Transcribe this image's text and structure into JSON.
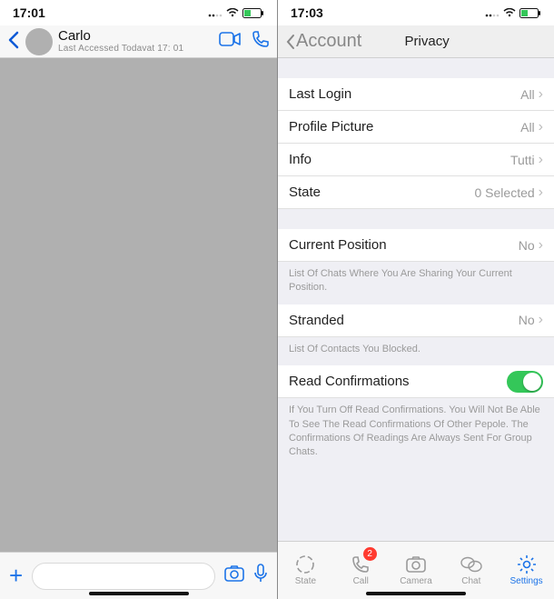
{
  "left": {
    "statusbar": {
      "time": "17:01"
    },
    "header": {
      "contact_name": "Carlo",
      "status_line": "Last Accessed Todavat 17: 01"
    },
    "composer": {
      "placeholder": ""
    }
  },
  "right": {
    "statusbar": {
      "time": "17:03"
    },
    "header": {
      "back_label": "Account",
      "title": "Privacy"
    },
    "rows": {
      "last_login": {
        "label": "Last Login",
        "value": "All"
      },
      "profile_picture": {
        "label": "Profile Picture",
        "value": "All"
      },
      "info": {
        "label": "Info",
        "value": "Tutti"
      },
      "state": {
        "label": "State",
        "value": "0 Selected"
      },
      "current_position": {
        "label": "Current Position",
        "value": "No"
      },
      "stranded": {
        "label": "Stranded",
        "value": "No"
      },
      "read_confirmations": {
        "label": "Read Confirmations",
        "on": true
      }
    },
    "hints": {
      "position": "List Of Chats Where You Are Sharing Your Current Position.",
      "stranded": "List Of Contacts You Blocked.",
      "read": "If You Turn Off Read Confirmations. You Will Not Be Able To See The Read Confirmations Of Other Pepole. The Confirmations Of Readings Are Always Sent For Group Chats."
    },
    "tabs": {
      "state": "State",
      "calls": "Call",
      "calls_badge": "2",
      "camera": "Camera",
      "chat": "Chat",
      "settings": "Settings"
    }
  }
}
